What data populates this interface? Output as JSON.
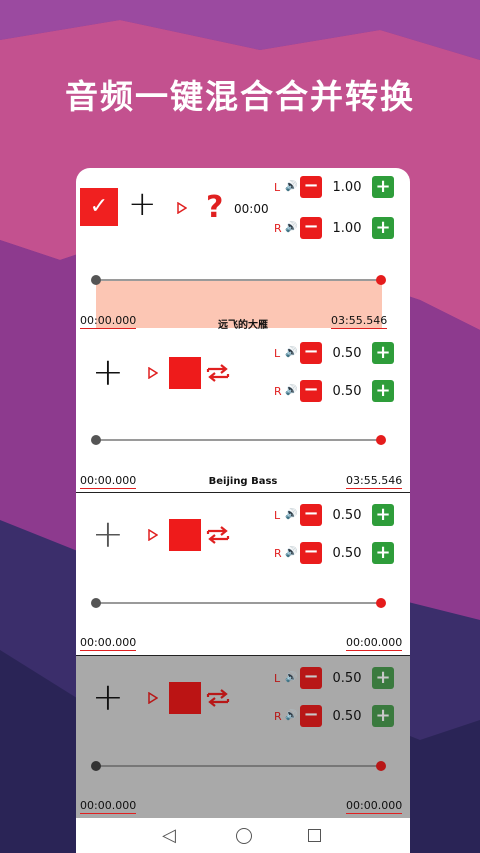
{
  "headline": "音频一键混合合并转换",
  "colors": {
    "accent": "#ea1c1c",
    "plus_green": "#2e9d3a",
    "selection": "#fcc6b4"
  },
  "channels": {
    "left": "L",
    "right": "R"
  },
  "icons": {
    "check": "✓",
    "plus": "+",
    "minus": "−",
    "question": "?",
    "speaker": "🔊",
    "back": "◁"
  },
  "tracks": [
    {
      "timer": "00:00",
      "left_volume": "1.00",
      "right_volume": "1.00",
      "start_time": "00:00.000",
      "end_time": "03:55.546",
      "title": "远飞的大雁"
    },
    {
      "left_volume": "0.50",
      "right_volume": "0.50",
      "start_time": "00:00.000",
      "end_time": "03:55.546",
      "title": "Beijing Bass"
    },
    {
      "left_volume": "0.50",
      "right_volume": "0.50",
      "start_time": "00:00.000",
      "end_time": "00:00.000"
    },
    {
      "left_volume": "0.50",
      "right_volume": "0.50",
      "start_time": "00:00.000",
      "end_time": "00:00.000"
    }
  ]
}
